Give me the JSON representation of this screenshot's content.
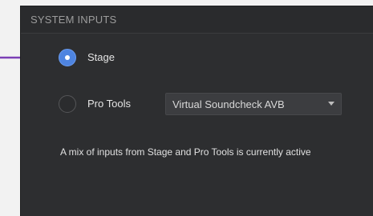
{
  "panel": {
    "title": "SYSTEM INPUTS"
  },
  "inputs": {
    "options": [
      {
        "label": "Stage",
        "selected": true
      },
      {
        "label": "Pro Tools",
        "selected": false
      }
    ],
    "pro_tools_source": {
      "selected_value": "Virtual Soundcheck AVB"
    }
  },
  "status": {
    "message": "A mix of inputs from Stage and Pro Tools is currently active"
  },
  "colors": {
    "panel_background": "#2d2e30",
    "radio_selected": "#4e84e0",
    "annotation_arrow": "#7b3fb5"
  },
  "icons": {
    "annotation": "arrow-right-icon",
    "dropdown": "chevron-down-icon"
  }
}
